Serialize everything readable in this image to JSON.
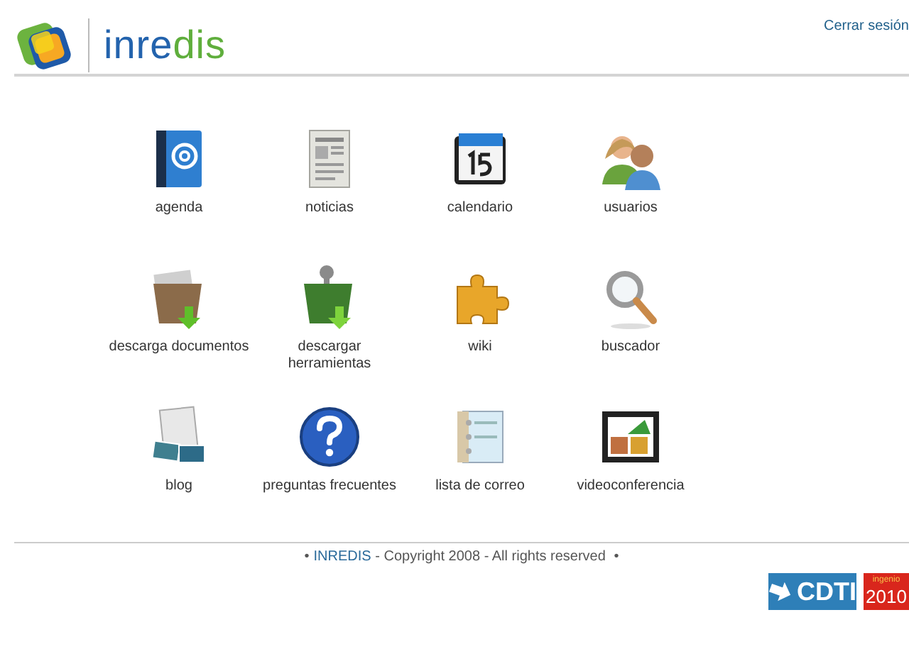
{
  "header": {
    "logo": {
      "parts": [
        {
          "text": "inre",
          "color": "#2363ad"
        },
        {
          "text": "dis",
          "color": "#5fae3c"
        }
      ]
    },
    "logout_link": "Cerrar sesión"
  },
  "apps": [
    {
      "label": "agenda"
    },
    {
      "label": "noticias"
    },
    {
      "label": "calendario"
    },
    {
      "label": "usuarios"
    },
    {
      "label": "descarga documentos"
    },
    {
      "label": "descargar herramientas"
    },
    {
      "label": "wiki"
    },
    {
      "label": "buscador"
    },
    {
      "label": "blog"
    },
    {
      "label": "preguntas frecuentes"
    },
    {
      "label": "lista de correo"
    },
    {
      "label": "videoconferencia"
    }
  ],
  "footer": {
    "bullet_left": "•",
    "link": "INREDIS",
    "text": " - Copyright 2008 - All rights reserved ",
    "bullet_right": "•"
  },
  "sponsors": [
    {
      "kind": "cdti",
      "text": "CDTI"
    },
    {
      "kind": "ingenio",
      "top": "ingenio",
      "text": "2010"
    }
  ]
}
